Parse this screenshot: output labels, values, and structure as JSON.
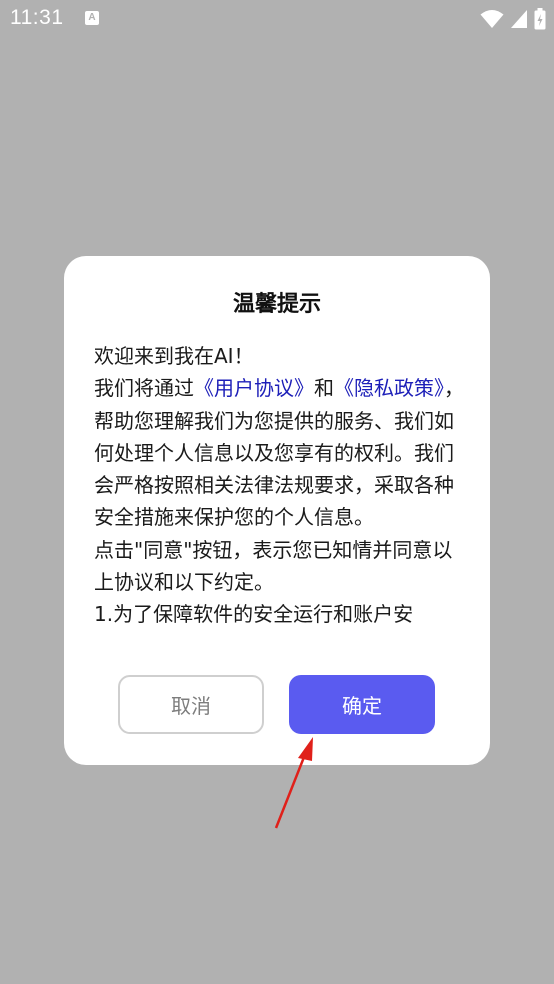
{
  "status_bar": {
    "time": "11:31",
    "notification_icon": "A",
    "icons": [
      "wifi-icon",
      "signal-icon",
      "battery-charging-icon"
    ]
  },
  "dialog": {
    "title": "温馨提示",
    "welcome": "欢迎来到我在AI！",
    "p1_a": " 我们将通过",
    "user_agreement": "《用户协议》",
    "p1_b": "和",
    "privacy_policy": "《隐私政策》",
    "p1_c": "，帮助您理解我们为您提供的服务、我们如何处理个人信息以及您享有的权利。我们会严格按照相关法律法规要求，采取各种安全措施来保护您的个人信息。",
    "p2": " 点击\"同意\"按钮，表示您已知情并同意以上协议和以下约定。",
    "p3": " 1.为了保障软件的安全运行和账户安",
    "cancel_label": "取消",
    "confirm_label": "确定"
  },
  "colors": {
    "backdrop": "#b1b1b1",
    "link": "#1d1fb8",
    "confirm_button": "#5a5bf0",
    "annotation_arrow": "#e0201a"
  }
}
